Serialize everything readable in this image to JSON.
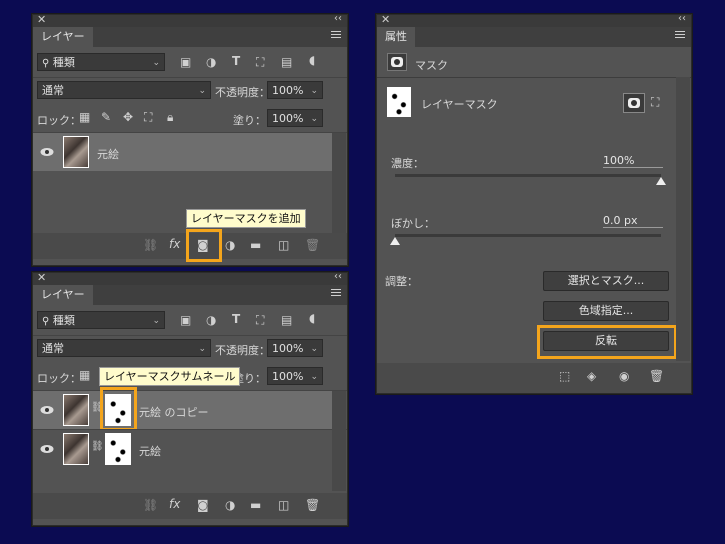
{
  "panel_layers_top": {
    "tab": "レイヤー",
    "filter_kind": "種類",
    "blend_mode": "通常",
    "opacity_label": "不透明度：",
    "opacity_value": "100%",
    "lock_label": "ロック：",
    "fill_label": "塗り：",
    "fill_value": "100%",
    "layers": [
      {
        "name": "元絵"
      }
    ],
    "tooltip": "レイヤーマスクを追加"
  },
  "panel_layers_bottom": {
    "tab": "レイヤー",
    "filter_kind": "種類",
    "blend_mode": "通常",
    "opacity_label": "不透明度：",
    "opacity_value": "100%",
    "lock_label": "ロック：",
    "fill_label": "塗り：",
    "fill_value": "100%",
    "layers": [
      {
        "name": "元絵 のコピー"
      },
      {
        "name": "元絵"
      }
    ],
    "tooltip": "レイヤーマスクサムネール"
  },
  "panel_properties": {
    "tab": "属性",
    "section_title": "マスク",
    "mask_type": "レイヤーマスク",
    "density_label": "濃度：",
    "density_value": "100%",
    "density_level": 1.0,
    "feather_label": "ぼかし：",
    "feather_value": "0.0 px",
    "feather_level": 0.0,
    "adjust_label": "調整：",
    "btn_select_mask": "選択とマスク...",
    "btn_color_range": "色域指定...",
    "btn_invert": "反転"
  },
  "colors": {
    "background": "#0b0b52",
    "panel": "#535353",
    "highlight": "#f4a51c",
    "tooltip": "#fffccc"
  }
}
